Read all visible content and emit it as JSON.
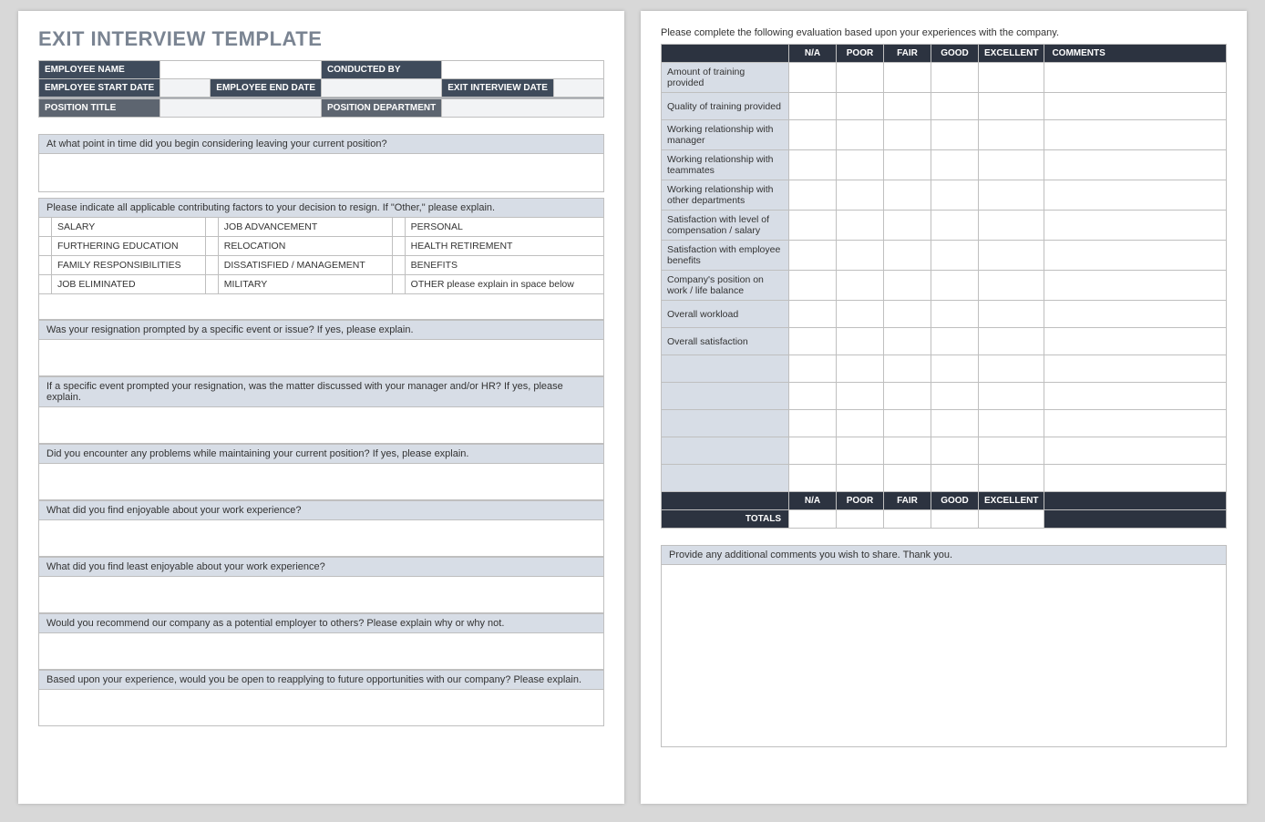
{
  "title": "EXIT INTERVIEW TEMPLATE",
  "header": {
    "emp_name_label": "EMPLOYEE NAME",
    "conducted_by_label": "CONDUCTED BY",
    "start_date_label": "EMPLOYEE START DATE",
    "end_date_label": "EMPLOYEE END DATE",
    "interview_date_label": "EXIT INTERVIEW DATE",
    "position_title_label": "POSITION TITLE",
    "position_dept_label": "POSITION DEPARTMENT"
  },
  "questions": {
    "q1": "At what point in time did you begin considering leaving your current position?",
    "q2": "Please indicate all applicable contributing factors to your decision to resign. If \"Other,\" please explain.",
    "q3": "Was your resignation prompted by a specific event or issue? If yes, please explain.",
    "q4": "If a specific event prompted your resignation, was the matter discussed with your manager and/or HR? If yes, please explain.",
    "q5": "Did you encounter any problems while maintaining your current position?  If yes, please explain.",
    "q6": "What did you find enjoyable about your work experience?",
    "q7": "What did you find least enjoyable about your work experience?",
    "q8": "Would you recommend our company as a potential employer to others? Please explain why or why not.",
    "q9": "Based upon your experience, would you be open to reapplying to future opportunities with our company?  Please explain."
  },
  "factors": {
    "r1c1": "SALARY",
    "r1c2": "JOB ADVANCEMENT",
    "r1c3": "PERSONAL",
    "r2c1": "FURTHERING EDUCATION",
    "r2c2": "RELOCATION",
    "r2c3": "HEALTH RETIREMENT",
    "r3c1": "FAMILY RESPONSIBILITIES",
    "r3c2": "DISSATISFIED / MANAGEMENT",
    "r3c3": "BENEFITS",
    "r4c1": "JOB ELIMINATED",
    "r4c2": "MILITARY",
    "r4c3": "OTHER please explain in space below"
  },
  "eval": {
    "instr": "Please complete the following evaluation based upon your experiences with the company.",
    "cols": {
      "na": "N/A",
      "poor": "POOR",
      "fair": "FAIR",
      "good": "GOOD",
      "excellent": "EXCELLENT",
      "comments": "COMMENTS"
    },
    "rows": {
      "r1": "Amount of training provided",
      "r2": "Quality of training provided",
      "r3": "Working relationship with manager",
      "r4": "Working relationship with teammates",
      "r5": "Working relationship with other departments",
      "r6": "Satisfaction with level of compensation / salary",
      "r7": "Satisfaction with employee benefits",
      "r8": "Company's position on work / life balance",
      "r9": "Overall workload",
      "r10": "Overall satisfaction"
    },
    "totals_label": "TOTALS"
  },
  "additional_comments_label": "Provide any additional comments you wish to share.  Thank you."
}
